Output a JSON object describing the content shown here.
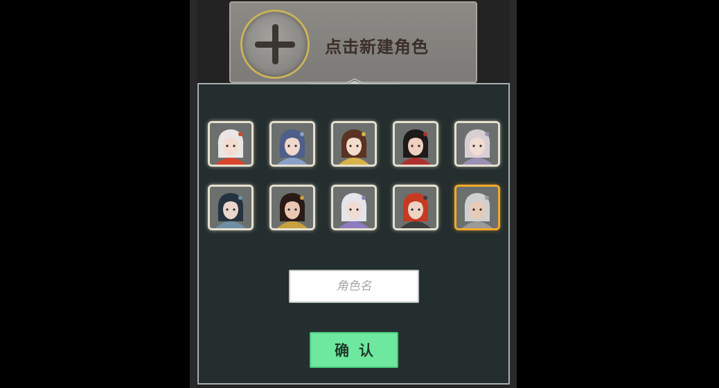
{
  "create_role": {
    "label": "点击新建角色"
  },
  "characters": [
    {
      "name": "avatar-1",
      "hair": "#e9e6e3",
      "accent": "#d9452d",
      "skin": "#f3ddd0",
      "selected": false
    },
    {
      "name": "avatar-2",
      "hair": "#4d5f8a",
      "accent": "#8aa0c8",
      "skin": "#f1d8cc",
      "selected": false
    },
    {
      "name": "avatar-3",
      "hair": "#5a3322",
      "accent": "#d8b24a",
      "skin": "#f4dccd",
      "selected": false
    },
    {
      "name": "avatar-4",
      "hair": "#1d1a1a",
      "accent": "#b03030",
      "skin": "#efd0c0",
      "selected": false
    },
    {
      "name": "avatar-5",
      "hair": "#d8cfd5",
      "accent": "#9c8fb5",
      "skin": "#f2dcd2",
      "selected": false
    },
    {
      "name": "avatar-6",
      "hair": "#253240",
      "accent": "#6f8fa5",
      "skin": "#ead6cb",
      "selected": false
    },
    {
      "name": "avatar-7",
      "hair": "#2a1a16",
      "accent": "#c9a03e",
      "skin": "#e9c7b2",
      "selected": false
    },
    {
      "name": "avatar-8",
      "hair": "#e4e4ea",
      "accent": "#8d7cc0",
      "skin": "#f0dcd3",
      "selected": false
    },
    {
      "name": "avatar-9",
      "hair": "#c73a22",
      "accent": "#3d3d3d",
      "skin": "#eed2c2",
      "selected": false
    },
    {
      "name": "avatar-10",
      "hair": "#cfd0cf",
      "accent": "#9a9a9a",
      "skin": "#e8cbb6",
      "selected": true
    }
  ],
  "name_input": {
    "value": "",
    "placeholder": "角色名"
  },
  "confirm": {
    "label": "确认"
  },
  "colors": {
    "panel_bg": "#252e2e",
    "confirm_bg": "#6ee89f",
    "selected_border": "#f3a92b"
  }
}
